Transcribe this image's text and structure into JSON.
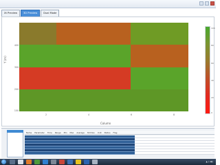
{
  "tabs": [
    {
      "label": "Xt Preview"
    },
    {
      "label": "3D Preview"
    },
    {
      "label": "Dual Mode"
    }
  ],
  "heatmap": {
    "rows": [
      [
        "#8a7a2c",
        "#b8611f",
        "#b8611f",
        "#6f9b25"
      ],
      [
        "#5aa42a",
        "#5aa42a",
        "#5aa42a",
        "#b8611f"
      ],
      [
        "#d53b24",
        "#d53b24",
        "#d53b24",
        "#5aa42a"
      ],
      [
        "#5e9726",
        "#5e9726",
        "#5e9726",
        "#5e9726"
      ]
    ]
  },
  "axes": {
    "ylabel": "Y (m)",
    "xlabel": "Column",
    "yticks": [
      "400",
      "300",
      "200",
      "100"
    ],
    "xticks": [
      "2",
      "4",
      "6",
      "8"
    ]
  },
  "colorbar": {
    "ticks": [
      "100",
      "80",
      "60",
      "40",
      "20",
      "0"
    ]
  },
  "grid": {
    "headers": [
      "Name",
      "Parameter",
      "Time",
      "Range",
      "Min",
      "Max",
      "Average",
      "Std Dev",
      "Unit",
      "Status",
      "Flag"
    ]
  }
}
